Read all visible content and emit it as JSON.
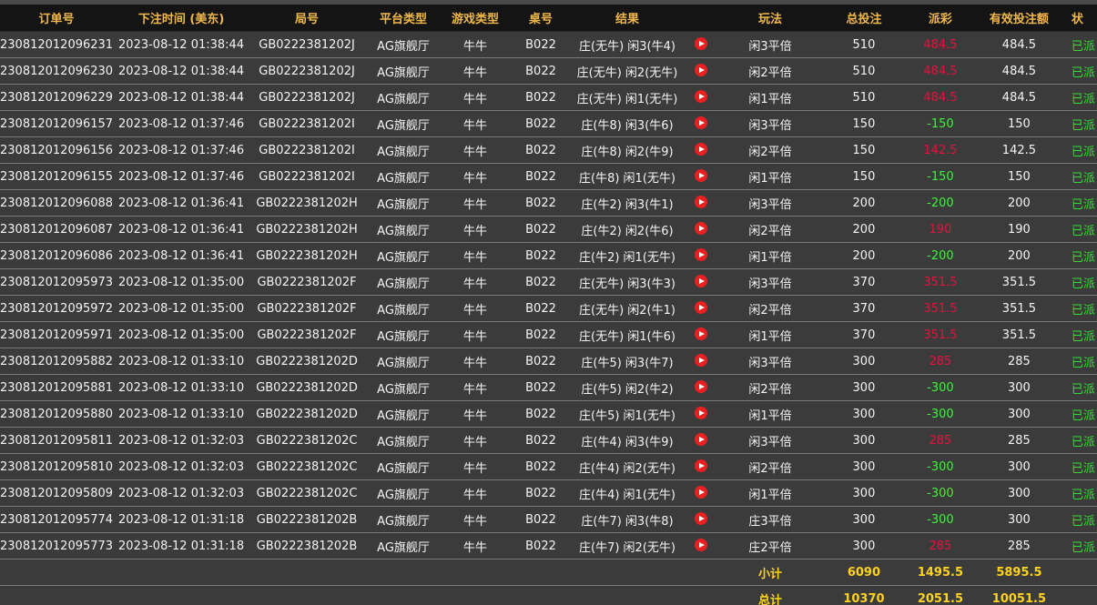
{
  "headers": [
    "订单号",
    "下注时间 (美东)",
    "局号",
    "平台类型",
    "游戏类型",
    "桌号",
    "结果",
    "",
    "玩法",
    "总投注",
    "派彩",
    "有效投注额",
    "状"
  ],
  "rows": [
    {
      "order": "230812012096231",
      "time": "2023-08-12 01:38:44",
      "round": "GB0222381202J",
      "platform": "AG旗舰厅",
      "game": "牛牛",
      "table": "B022",
      "result": "庄(无牛) 闲3(牛4)",
      "play": "闲3平倍",
      "bet": "510",
      "payout": "484.5",
      "payout_type": "pos",
      "valid": "484.5",
      "status": "已派"
    },
    {
      "order": "230812012096230",
      "time": "2023-08-12 01:38:44",
      "round": "GB0222381202J",
      "platform": "AG旗舰厅",
      "game": "牛牛",
      "table": "B022",
      "result": "庄(无牛) 闲2(无牛)",
      "play": "闲2平倍",
      "bet": "510",
      "payout": "484.5",
      "payout_type": "pos",
      "valid": "484.5",
      "status": "已派"
    },
    {
      "order": "230812012096229",
      "time": "2023-08-12 01:38:44",
      "round": "GB0222381202J",
      "platform": "AG旗舰厅",
      "game": "牛牛",
      "table": "B022",
      "result": "庄(无牛) 闲1(无牛)",
      "play": "闲1平倍",
      "bet": "510",
      "payout": "484.5",
      "payout_type": "pos",
      "valid": "484.5",
      "status": "已派"
    },
    {
      "order": "230812012096157",
      "time": "2023-08-12 01:37:46",
      "round": "GB0222381202I",
      "platform": "AG旗舰厅",
      "game": "牛牛",
      "table": "B022",
      "result": "庄(牛8) 闲3(牛6)",
      "play": "闲3平倍",
      "bet": "150",
      "payout": "-150",
      "payout_type": "neg",
      "valid": "150",
      "status": "已派"
    },
    {
      "order": "230812012096156",
      "time": "2023-08-12 01:37:46",
      "round": "GB0222381202I",
      "platform": "AG旗舰厅",
      "game": "牛牛",
      "table": "B022",
      "result": "庄(牛8) 闲2(牛9)",
      "play": "闲2平倍",
      "bet": "150",
      "payout": "142.5",
      "payout_type": "pos",
      "valid": "142.5",
      "status": "已派"
    },
    {
      "order": "230812012096155",
      "time": "2023-08-12 01:37:46",
      "round": "GB0222381202I",
      "platform": "AG旗舰厅",
      "game": "牛牛",
      "table": "B022",
      "result": "庄(牛8) 闲1(无牛)",
      "play": "闲1平倍",
      "bet": "150",
      "payout": "-150",
      "payout_type": "neg",
      "valid": "150",
      "status": "已派"
    },
    {
      "order": "230812012096088",
      "time": "2023-08-12 01:36:41",
      "round": "GB0222381202H",
      "platform": "AG旗舰厅",
      "game": "牛牛",
      "table": "B022",
      "result": "庄(牛2) 闲3(牛1)",
      "play": "闲3平倍",
      "bet": "200",
      "payout": "-200",
      "payout_type": "neg",
      "valid": "200",
      "status": "已派"
    },
    {
      "order": "230812012096087",
      "time": "2023-08-12 01:36:41",
      "round": "GB0222381202H",
      "platform": "AG旗舰厅",
      "game": "牛牛",
      "table": "B022",
      "result": "庄(牛2) 闲2(牛6)",
      "play": "闲2平倍",
      "bet": "200",
      "payout": "190",
      "payout_type": "pos",
      "valid": "190",
      "status": "已派"
    },
    {
      "order": "230812012096086",
      "time": "2023-08-12 01:36:41",
      "round": "GB0222381202H",
      "platform": "AG旗舰厅",
      "game": "牛牛",
      "table": "B022",
      "result": "庄(牛2) 闲1(无牛)",
      "play": "闲1平倍",
      "bet": "200",
      "payout": "-200",
      "payout_type": "neg",
      "valid": "200",
      "status": "已派"
    },
    {
      "order": "230812012095973",
      "time": "2023-08-12 01:35:00",
      "round": "GB0222381202F",
      "platform": "AG旗舰厅",
      "game": "牛牛",
      "table": "B022",
      "result": "庄(无牛) 闲3(牛3)",
      "play": "闲3平倍",
      "bet": "370",
      "payout": "351.5",
      "payout_type": "pos",
      "valid": "351.5",
      "status": "已派"
    },
    {
      "order": "230812012095972",
      "time": "2023-08-12 01:35:00",
      "round": "GB0222381202F",
      "platform": "AG旗舰厅",
      "game": "牛牛",
      "table": "B022",
      "result": "庄(无牛) 闲2(牛1)",
      "play": "闲2平倍",
      "bet": "370",
      "payout": "351.5",
      "payout_type": "pos",
      "valid": "351.5",
      "status": "已派"
    },
    {
      "order": "230812012095971",
      "time": "2023-08-12 01:35:00",
      "round": "GB0222381202F",
      "platform": "AG旗舰厅",
      "game": "牛牛",
      "table": "B022",
      "result": "庄(无牛) 闲1(牛6)",
      "play": "闲1平倍",
      "bet": "370",
      "payout": "351.5",
      "payout_type": "pos",
      "valid": "351.5",
      "status": "已派"
    },
    {
      "order": "230812012095882",
      "time": "2023-08-12 01:33:10",
      "round": "GB0222381202D",
      "platform": "AG旗舰厅",
      "game": "牛牛",
      "table": "B022",
      "result": "庄(牛5) 闲3(牛7)",
      "play": "闲3平倍",
      "bet": "300",
      "payout": "285",
      "payout_type": "pos",
      "valid": "285",
      "status": "已派"
    },
    {
      "order": "230812012095881",
      "time": "2023-08-12 01:33:10",
      "round": "GB0222381202D",
      "platform": "AG旗舰厅",
      "game": "牛牛",
      "table": "B022",
      "result": "庄(牛5) 闲2(牛2)",
      "play": "闲2平倍",
      "bet": "300",
      "payout": "-300",
      "payout_type": "neg",
      "valid": "300",
      "status": "已派"
    },
    {
      "order": "230812012095880",
      "time": "2023-08-12 01:33:10",
      "round": "GB0222381202D",
      "platform": "AG旗舰厅",
      "game": "牛牛",
      "table": "B022",
      "result": "庄(牛5) 闲1(无牛)",
      "play": "闲1平倍",
      "bet": "300",
      "payout": "-300",
      "payout_type": "neg",
      "valid": "300",
      "status": "已派"
    },
    {
      "order": "230812012095811",
      "time": "2023-08-12 01:32:03",
      "round": "GB0222381202C",
      "platform": "AG旗舰厅",
      "game": "牛牛",
      "table": "B022",
      "result": "庄(牛4) 闲3(牛9)",
      "play": "闲3平倍",
      "bet": "300",
      "payout": "285",
      "payout_type": "pos",
      "valid": "285",
      "status": "已派"
    },
    {
      "order": "230812012095810",
      "time": "2023-08-12 01:32:03",
      "round": "GB0222381202C",
      "platform": "AG旗舰厅",
      "game": "牛牛",
      "table": "B022",
      "result": "庄(牛4) 闲2(无牛)",
      "play": "闲2平倍",
      "bet": "300",
      "payout": "-300",
      "payout_type": "neg",
      "valid": "300",
      "status": "已派"
    },
    {
      "order": "230812012095809",
      "time": "2023-08-12 01:32:03",
      "round": "GB0222381202C",
      "platform": "AG旗舰厅",
      "game": "牛牛",
      "table": "B022",
      "result": "庄(牛4) 闲1(无牛)",
      "play": "闲1平倍",
      "bet": "300",
      "payout": "-300",
      "payout_type": "neg",
      "valid": "300",
      "status": "已派"
    },
    {
      "order": "230812012095774",
      "time": "2023-08-12 01:31:18",
      "round": "GB0222381202B",
      "platform": "AG旗舰厅",
      "game": "牛牛",
      "table": "B022",
      "result": "庄(牛7) 闲3(牛8)",
      "play": "庄3平倍",
      "bet": "300",
      "payout": "-300",
      "payout_type": "neg",
      "valid": "300",
      "status": "已派"
    },
    {
      "order": "230812012095773",
      "time": "2023-08-12 01:31:18",
      "round": "GB0222381202B",
      "platform": "AG旗舰厅",
      "game": "牛牛",
      "table": "B022",
      "result": "庄(牛7) 闲2(无牛)",
      "play": "庄2平倍",
      "bet": "300",
      "payout": "285",
      "payout_type": "pos",
      "valid": "285",
      "status": "已派"
    }
  ],
  "subtotal": {
    "label": "小计",
    "bet": "6090",
    "payout": "1495.5",
    "valid": "5895.5"
  },
  "total": {
    "label": "总计",
    "bet": "10370",
    "payout": "2051.5",
    "valid": "10051.5"
  },
  "icons": {
    "result_video": "play-video-icon"
  },
  "colors": {
    "header_text": "#f0b84a",
    "summary_text": "#ffd21e",
    "negative": "#44ee44",
    "positive": "#e0143c",
    "status": "#33dd33"
  }
}
